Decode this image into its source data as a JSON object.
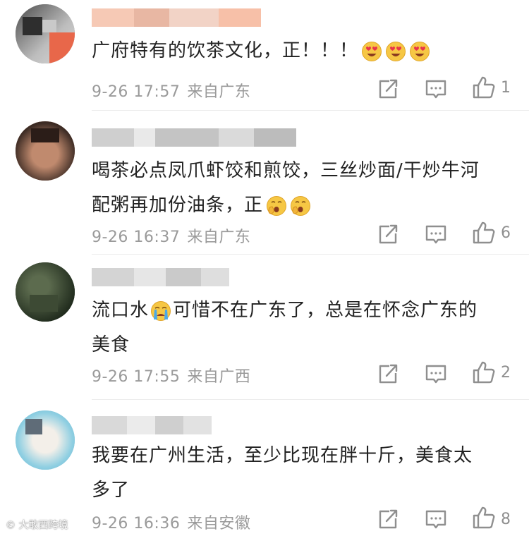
{
  "comments": [
    {
      "text": "广府特有的饮茶文化，正！！！",
      "emojis": [
        "heart-eyes",
        "heart-eyes",
        "heart-eyes"
      ],
      "time": "9-26 17:57",
      "location": "来自广东",
      "likes": "1"
    },
    {
      "text_line1": "喝茶必点凤爪虾饺和煎饺，三丝炒面/干炒牛河",
      "text_line2": "配粥再加份油条，正",
      "emojis": [
        "yawning-face",
        "yawning-face"
      ],
      "time": "9-26 16:37",
      "location": "来自广东",
      "likes": "6"
    },
    {
      "text_prefix": "流口水",
      "text_line1_rest": "可惜不在广东了，总是在怀念广东的",
      "text_line2": "美食",
      "emojis": [
        "crying-face"
      ],
      "time": "9-26 17:55",
      "location": "来自广西",
      "likes": "2"
    },
    {
      "text_line1": "我要在广州生活，至少比现在胖十斤，美食太",
      "text_line2": "多了",
      "time": "9-26 16:36",
      "location": "来自安徽",
      "likes": "8"
    }
  ],
  "watermark": "大敢西跨境",
  "colors": {
    "text": "#222222",
    "meta": "#9a9a9a",
    "icon": "#8f8f8f",
    "divider": "#ececec"
  },
  "icons": {
    "share": "share-icon",
    "comment": "comment-icon",
    "like": "thumbs-up-icon"
  }
}
